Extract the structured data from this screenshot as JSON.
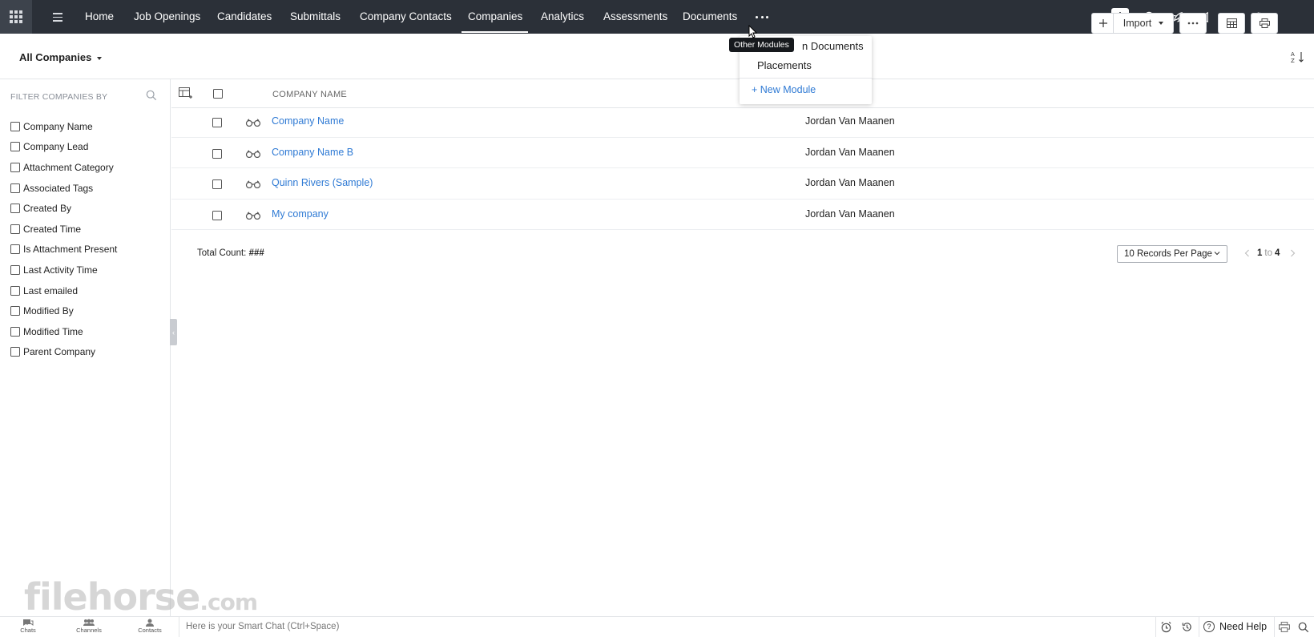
{
  "nav": {
    "items": [
      "Home",
      "Job Openings",
      "Candidates",
      "Submittals",
      "Company Contacts",
      "Companies",
      "Analytics",
      "Assessments",
      "Documents"
    ],
    "active": "Companies"
  },
  "toolbar": {
    "view_label": "All Companies",
    "import_label": "Import"
  },
  "sidebar": {
    "heading": "FILTER COMPANIES BY",
    "filters": [
      "Company Name",
      "Company Lead",
      "Attachment Category",
      "Associated Tags",
      "Created By",
      "Created Time",
      "Is Attachment Present",
      "Last Activity Time",
      "Last emailed",
      "Modified By",
      "Modified Time",
      "Parent Company"
    ]
  },
  "table": {
    "columns": [
      "COMPANY NAME"
    ],
    "rows": [
      {
        "name": "Company Name",
        "owner": "Jordan Van Maanen"
      },
      {
        "name": "Company Name B",
        "owner": "Jordan Van Maanen"
      },
      {
        "name": "Quinn Rivers (Sample)",
        "owner": "Jordan Van Maanen"
      },
      {
        "name": "My company",
        "owner": "Jordan Van Maanen"
      }
    ],
    "total_label": "Total Count:",
    "total_value": "###",
    "records_per_page": "10 Records Per Page",
    "page_from": "1",
    "page_to_label": "to",
    "page_to": "4"
  },
  "popup": {
    "tooltip": "Other Modules",
    "items": [
      "n Documents",
      "Placements"
    ],
    "new_module": "+ New Module"
  },
  "bottombar": {
    "chats": "Chats",
    "channels": "Channels",
    "contacts": "Contacts",
    "smartchat_placeholder": "Here is your Smart Chat (Ctrl+Space)",
    "help": "Need Help"
  },
  "watermark": {
    "main": "filehorse",
    "suffix": ".com"
  },
  "colors": {
    "nav_bg": "#2b3038",
    "link": "#2f7ad4",
    "accent_white": "#ffffff"
  }
}
